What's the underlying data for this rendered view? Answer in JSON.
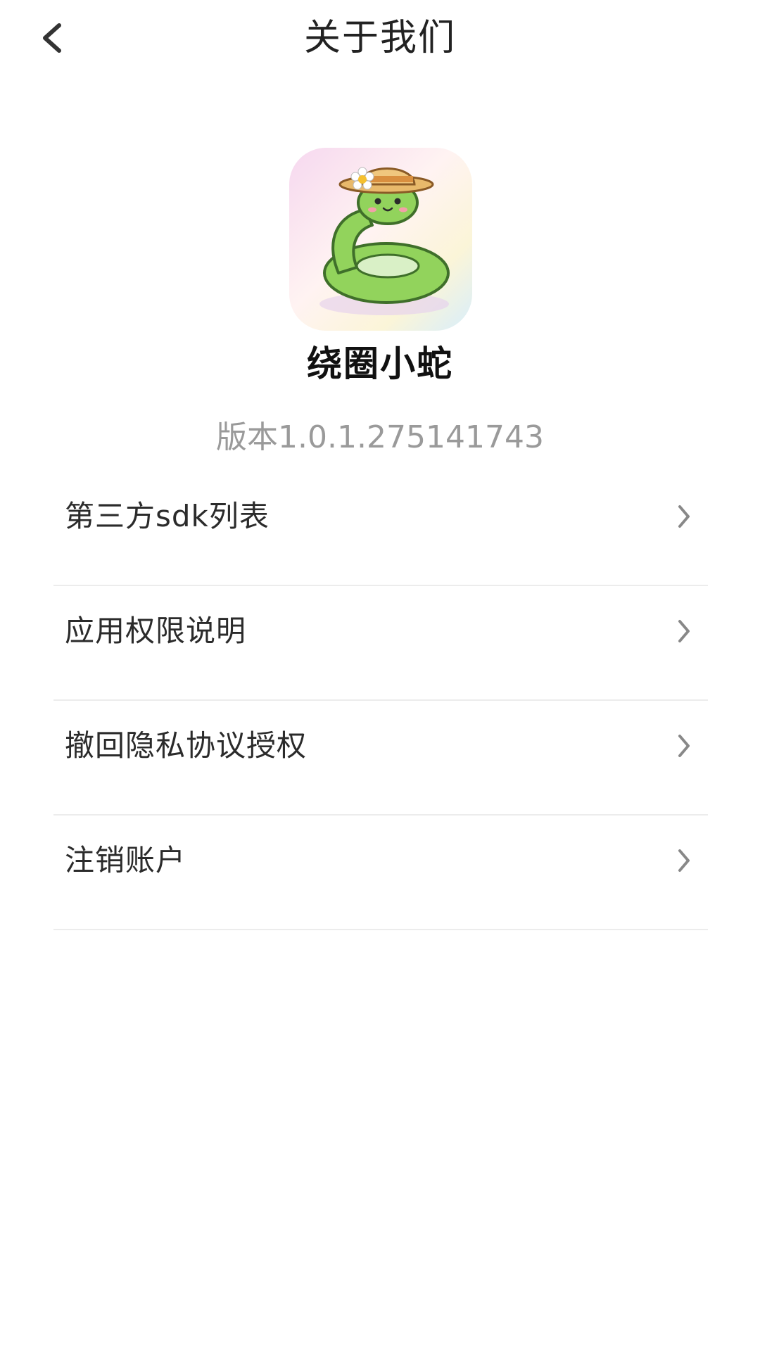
{
  "header": {
    "title": "关于我们",
    "back_icon": "chevron-left-icon"
  },
  "app": {
    "name": "绕圈小蛇",
    "version": "版本1.0.1.275141743",
    "icon": "snake-with-straw-hat-icon"
  },
  "menu": {
    "items": [
      {
        "label": "第三方sdk列表",
        "icon": "chevron-right-icon"
      },
      {
        "label": "应用权限说明",
        "icon": "chevron-right-icon"
      },
      {
        "label": "撤回隐私协议授权",
        "icon": "chevron-right-icon"
      },
      {
        "label": "注销账户",
        "icon": "chevron-right-icon"
      }
    ]
  },
  "colors": {
    "title": "#222222",
    "version": "#9a9a9a",
    "divider": "#ececec",
    "chevron": "#888888",
    "snake": "#8fd15a"
  }
}
